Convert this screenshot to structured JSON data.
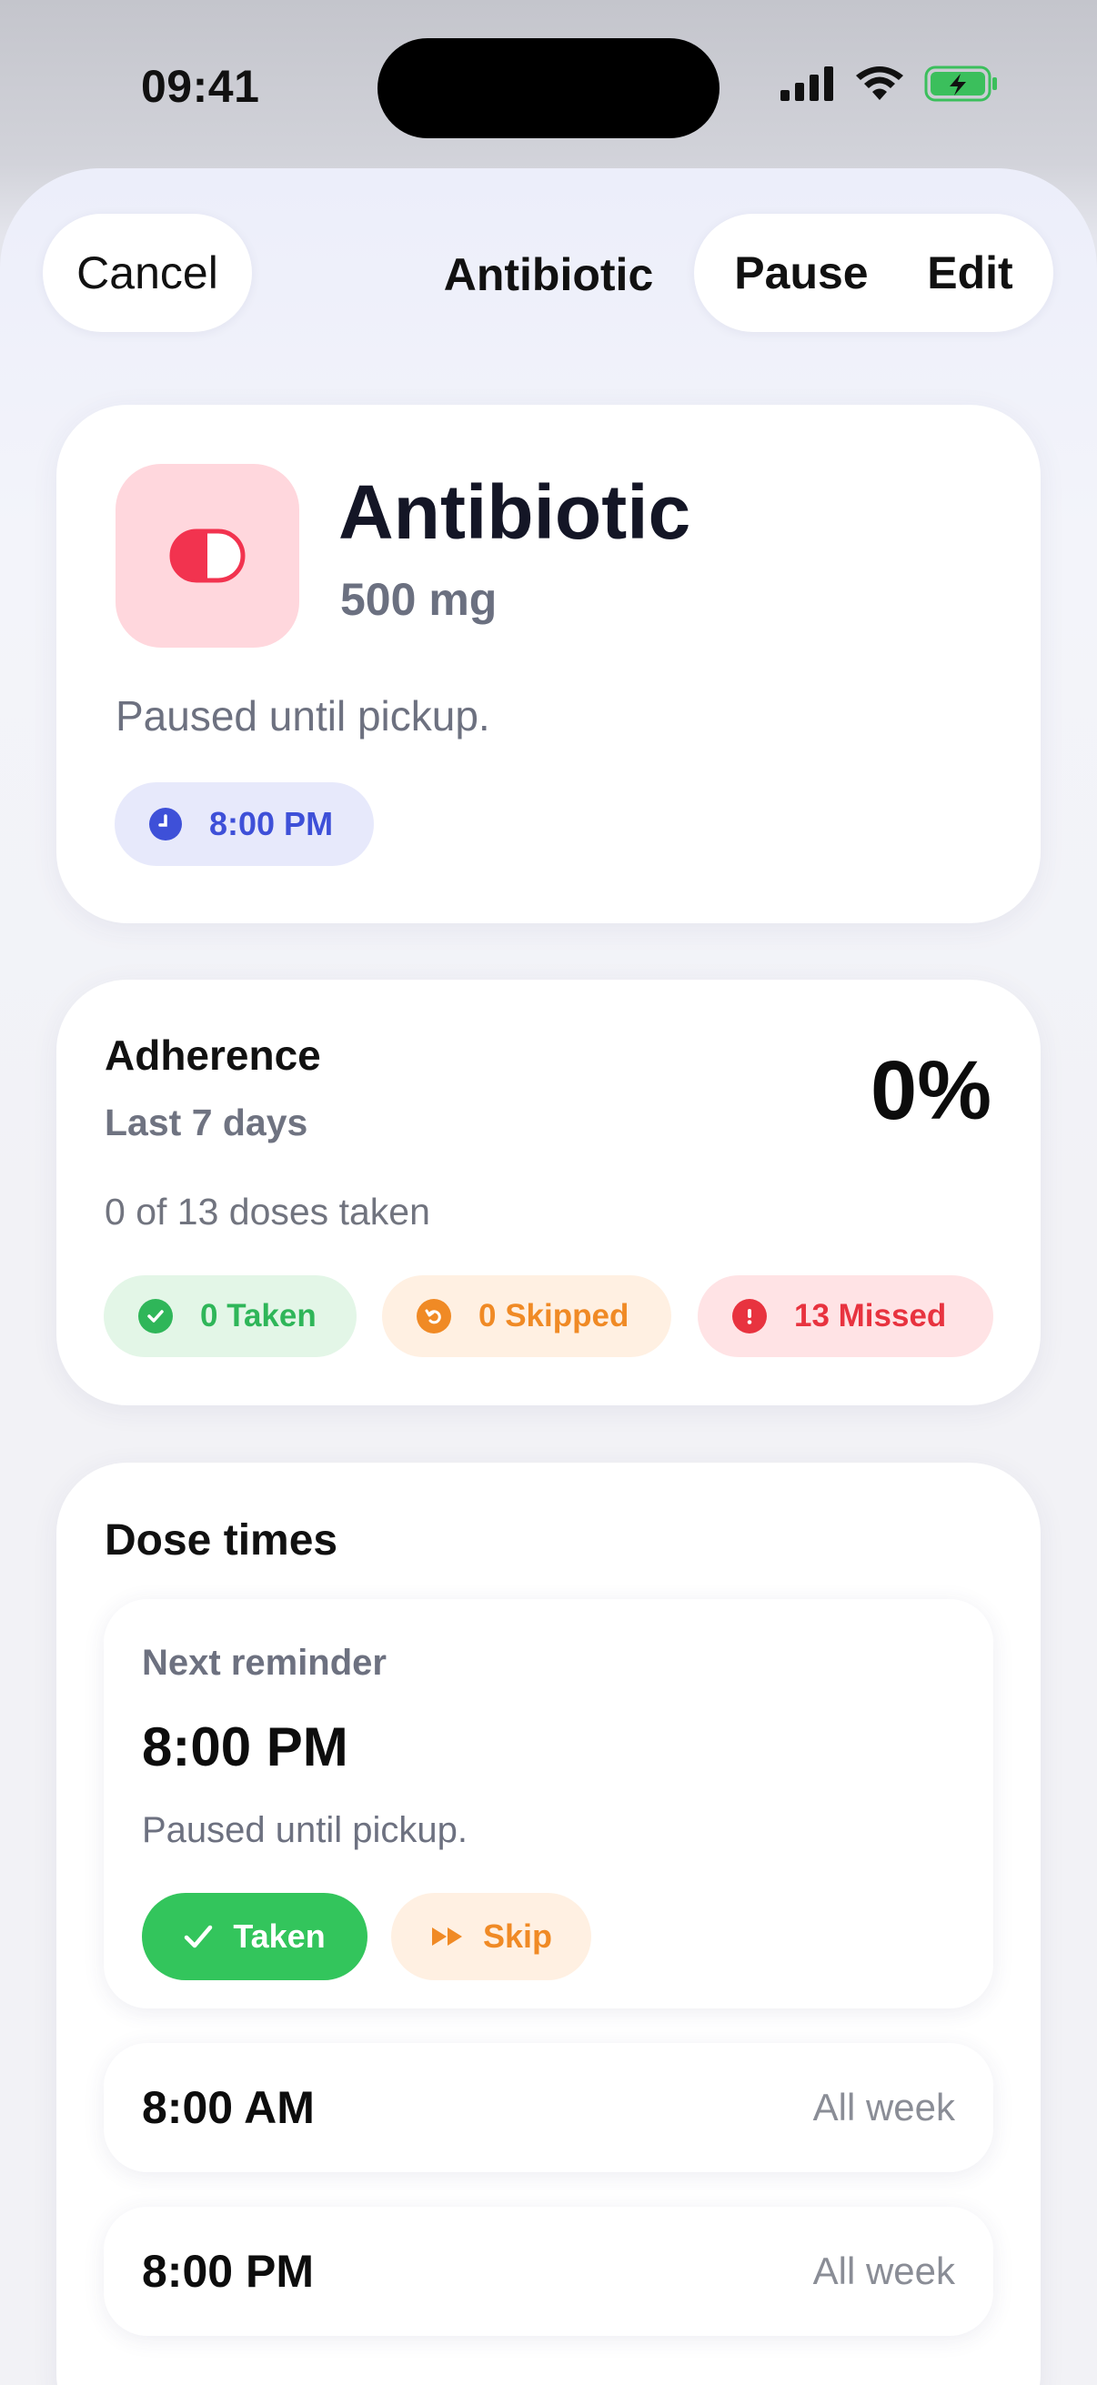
{
  "status_bar": {
    "time": "09:41"
  },
  "nav": {
    "cancel_label": "Cancel",
    "title": "Antibiotic",
    "pause_label": "Pause",
    "edit_label": "Edit"
  },
  "medication": {
    "name": "Antibiotic",
    "dose": "500 mg",
    "note": "Paused until pickup.",
    "time_chip": "8:00 PM",
    "icon": "pill-icon",
    "icon_color": "#f2334f"
  },
  "adherence": {
    "title": "Adherence",
    "period": "Last 7 days",
    "percent": "0%",
    "summary": "0 of 13 doses taken",
    "badges": {
      "taken": "0 Taken",
      "skipped": "0 Skipped",
      "missed": "13 Missed"
    },
    "colors": {
      "taken": "#2fb659",
      "skipped": "#f08a25",
      "missed": "#e8333f"
    }
  },
  "dose_times": {
    "title": "Dose times",
    "next": {
      "label": "Next reminder",
      "time": "8:00 PM",
      "note": "Paused until pickup.",
      "taken_label": "Taken",
      "skip_label": "Skip"
    },
    "rows": [
      {
        "time": "8:00 AM",
        "days": "All week"
      },
      {
        "time": "8:00 PM",
        "days": "All week"
      }
    ]
  }
}
